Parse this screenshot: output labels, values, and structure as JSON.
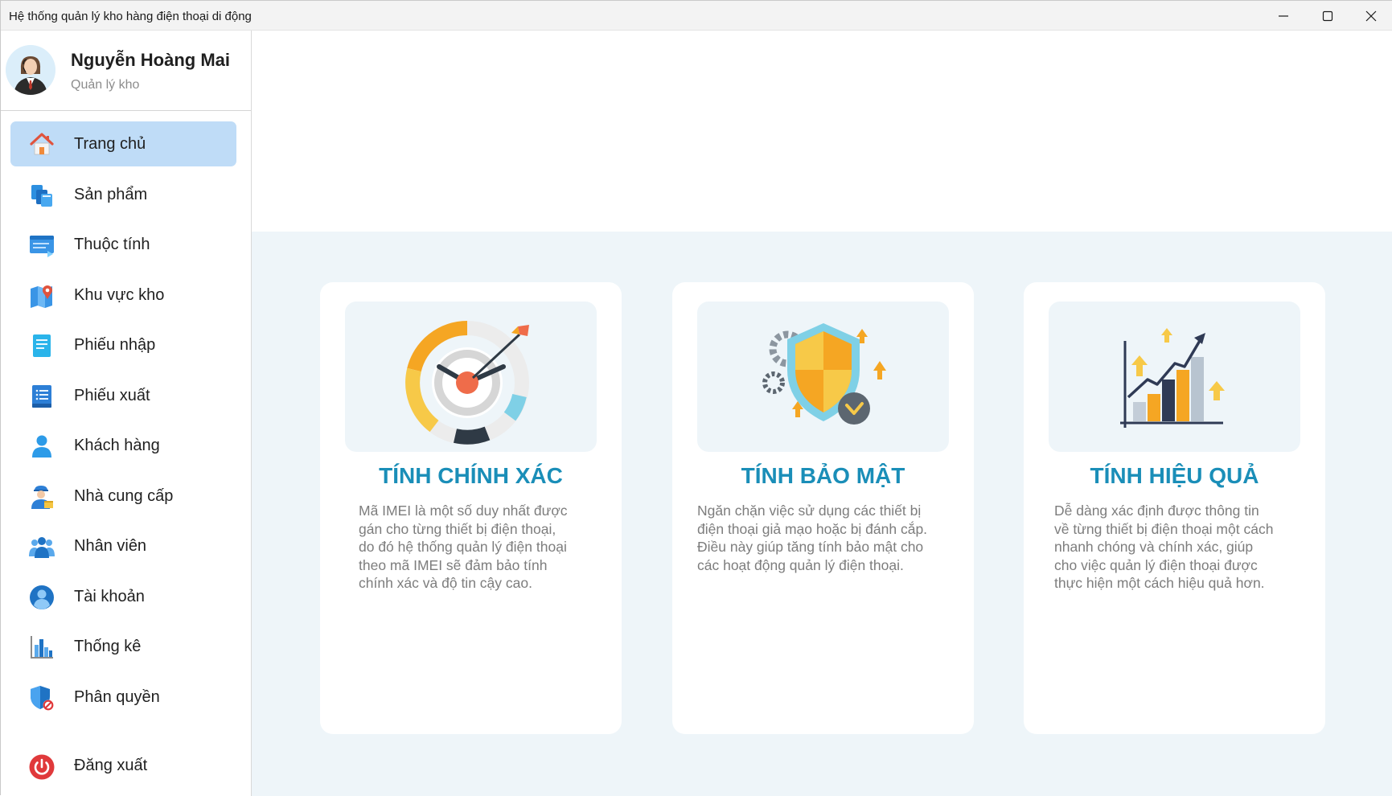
{
  "window": {
    "title": "Hệ thống quản lý kho hàng điện thoại di động",
    "controls": [
      "minimize-icon",
      "maximize-icon",
      "close-icon"
    ]
  },
  "profile": {
    "name": "Nguyễn Hoàng Mai",
    "role": "Quản lý kho"
  },
  "sidebar": {
    "items": [
      {
        "label": "Trang chủ",
        "icon": "home-icon",
        "active": true
      },
      {
        "label": "Sản phẩm",
        "icon": "products-icon",
        "active": false
      },
      {
        "label": "Thuộc tính",
        "icon": "attributes-icon",
        "active": false
      },
      {
        "label": "Khu vực kho",
        "icon": "warehouse-map-icon",
        "active": false
      },
      {
        "label": "Phiếu nhập",
        "icon": "import-receipt-icon",
        "active": false
      },
      {
        "label": "Phiếu xuất",
        "icon": "export-receipt-icon",
        "active": false
      },
      {
        "label": "Khách hàng",
        "icon": "customer-icon",
        "active": false
      },
      {
        "label": "Nhà cung cấp",
        "icon": "supplier-icon",
        "active": false
      },
      {
        "label": "Nhân viên",
        "icon": "employees-icon",
        "active": false
      },
      {
        "label": "Tài khoản",
        "icon": "account-icon",
        "active": false
      },
      {
        "label": "Thống kê",
        "icon": "statistics-icon",
        "active": false
      },
      {
        "label": "Phân quyền",
        "icon": "permission-shield-icon",
        "active": false
      }
    ],
    "logout_label": "Đăng xuất"
  },
  "cards": [
    {
      "title": "TÍNH CHÍNH XÁC",
      "icon": "target-accuracy-icon",
      "lines": [
        "Mã IMEI là một số duy nhất được",
        "gán cho từng thiết bị điện thoại,",
        "do đó hệ thống quản lý điện thoại",
        "theo mã IMEI sẽ đảm bảo tính",
        "chính xác và độ tin cậy cao."
      ]
    },
    {
      "title": "TÍNH BẢO MẬT",
      "icon": "security-shield-icon",
      "lines": [
        "Ngăn chặn việc sử dụng các thiết bị",
        "điện thoại giả mạo hoặc bị đánh cắp.",
        "Điều này giúp tăng tính bảo mật cho",
        "các hoạt động quản lý điện thoại."
      ]
    },
    {
      "title": "TÍNH HIỆU QUẢ",
      "icon": "growth-chart-icon",
      "lines": [
        "Dễ dàng xác định được thông tin",
        "về từng thiết bị điện thoại một cách",
        "nhanh chóng và chính xác, giúp",
        "cho việc quản lý điện thoại được",
        "thực hiện một cách hiệu quả hơn."
      ]
    }
  ],
  "colors": {
    "accent_title": "#1a8eb8",
    "active_nav": "#bfdcf7",
    "body_bg": "#eef5f9"
  }
}
